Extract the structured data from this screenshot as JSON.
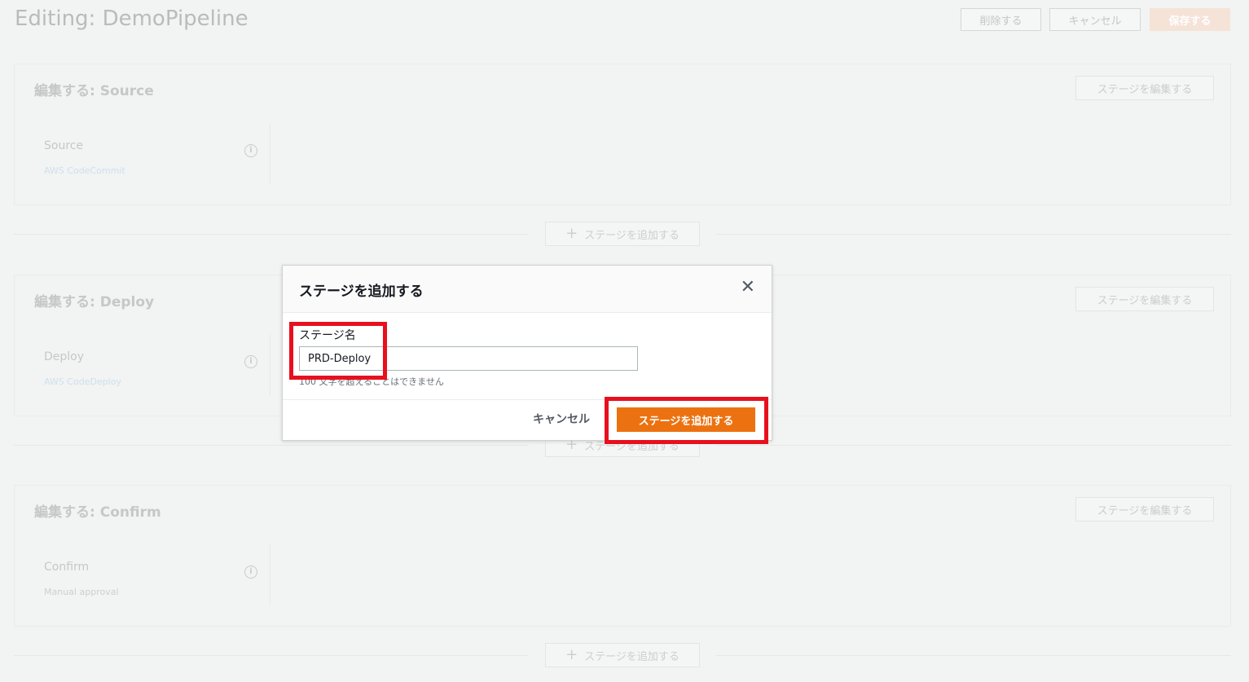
{
  "page": {
    "title": "Editing: DemoPipeline",
    "header_buttons": {
      "delete": "削除する",
      "cancel": "キャンセル",
      "save": "保存する"
    }
  },
  "stages": [
    {
      "title": "編集する: Source",
      "edit_label": "ステージを編集する",
      "action_name": "Source",
      "action_provider": "AWS CodeCommit"
    },
    {
      "title": "編集する: Deploy",
      "edit_label": "ステージを編集する",
      "action_name": "Deploy",
      "action_provider": "AWS CodeDeploy"
    },
    {
      "title": "編集する: Confirm",
      "edit_label": "ステージを編集する",
      "action_name": "Confirm",
      "action_provider": "Manual approval"
    }
  ],
  "add_stage_label": "ステージを追加する",
  "modal": {
    "title": "ステージを追加する",
    "field_label": "ステージ名",
    "field_value": "PRD-Deploy",
    "hint": "100 文字を超えることはできません",
    "cancel_label": "キャンセル",
    "submit_label": "ステージを追加する"
  },
  "colors": {
    "accent": "#ec7211",
    "annotation": "#e8101e"
  }
}
